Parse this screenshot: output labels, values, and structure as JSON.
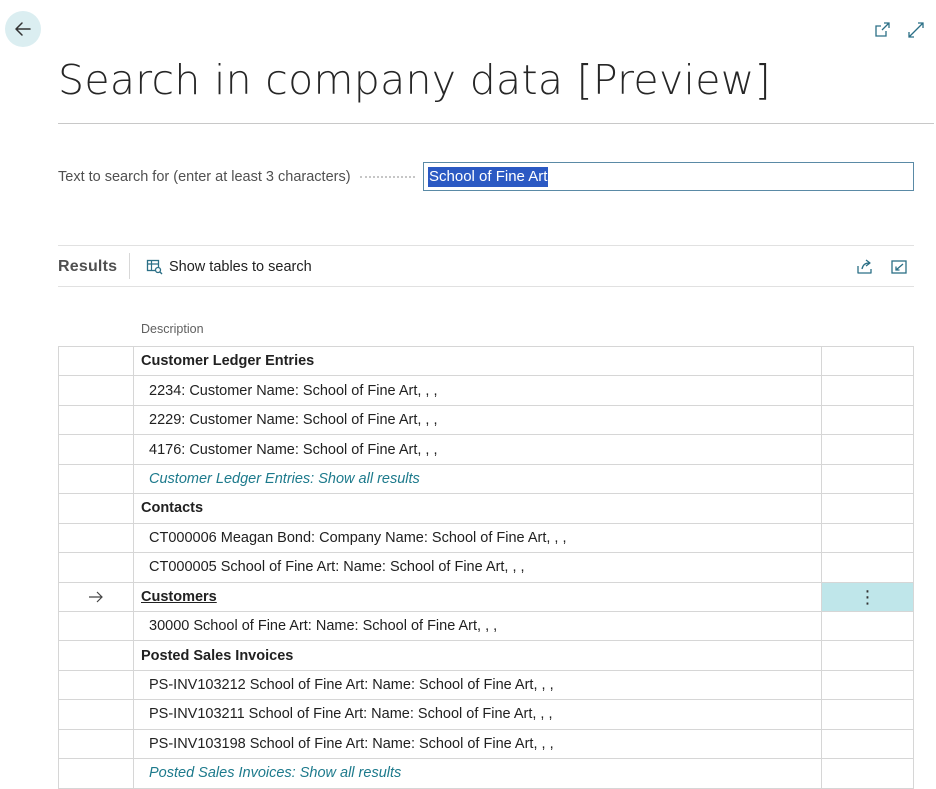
{
  "page": {
    "title": "Search in company data [Preview]"
  },
  "search": {
    "label": "Text to search for (enter at least 3 characters)",
    "value": "School of Fine Art"
  },
  "results": {
    "title": "Results",
    "show_tables_label": "Show tables to search",
    "column_header": "Description",
    "rows": [
      {
        "type": "group",
        "text": "Customer Ledger Entries"
      },
      {
        "type": "item",
        "text": "2234: Customer Name: School of Fine Art, , ,"
      },
      {
        "type": "item",
        "text": "2229: Customer Name: School of Fine Art, , ,"
      },
      {
        "type": "item",
        "text": "4176: Customer Name: School of Fine Art, , ,"
      },
      {
        "type": "link",
        "text": "Customer Ledger Entries: Show all results"
      },
      {
        "type": "group",
        "text": "Contacts"
      },
      {
        "type": "item",
        "text": "CT000006 Meagan Bond: Company Name: School of Fine Art, , ,"
      },
      {
        "type": "item",
        "text": "CT000005 School of Fine Art: Name: School of Fine Art, , ,"
      },
      {
        "type": "group",
        "text": "Customers",
        "selected": true
      },
      {
        "type": "item",
        "text": "30000 School of Fine Art: Name: School of Fine Art, , ,"
      },
      {
        "type": "group",
        "text": "Posted Sales Invoices"
      },
      {
        "type": "item",
        "text": "PS-INV103212 School of Fine Art: Name: School of Fine Art, , ,"
      },
      {
        "type": "item",
        "text": "PS-INV103211 School of Fine Art: Name: School of Fine Art, , ,"
      },
      {
        "type": "item",
        "text": "PS-INV103198 School of Fine Art: Name: School of Fine Art, , ,"
      },
      {
        "type": "link",
        "text": "Posted Sales Invoices: Show all results"
      }
    ]
  },
  "icons": {
    "back": "arrow-left-icon",
    "open_new_window": "open-in-new-window-icon",
    "expand": "expand-icon",
    "show_tables": "table-search-icon",
    "share": "share-icon",
    "focus_mode": "focus-mode-icon",
    "row_marker": "arrow-right-icon",
    "row_menu": "more-vertical-icon"
  },
  "colors": {
    "accent": "#1d7a8c",
    "selection": "#2b59c3",
    "selected_row_action": "#bfe6ea",
    "back_button_bg": "#dbeef1"
  }
}
